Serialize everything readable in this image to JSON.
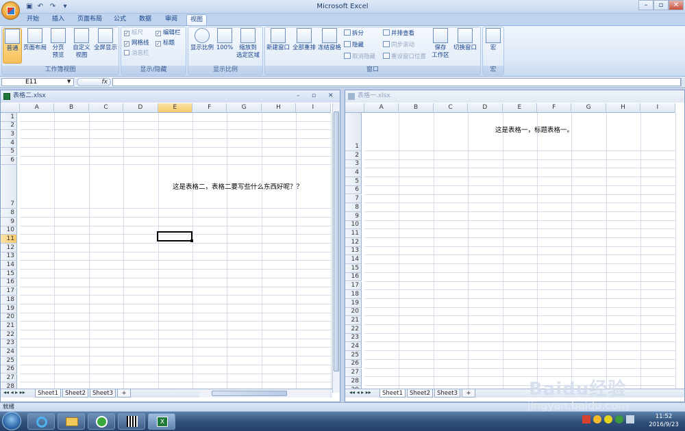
{
  "titlebar": {
    "title": "Microsoft Excel"
  },
  "tabs": [
    "开始",
    "插入",
    "页面布局",
    "公式",
    "数据",
    "审阅",
    "视图"
  ],
  "active_tab": "视图",
  "ribbon": {
    "views": {
      "label": "工作簿视图",
      "normal": "普通",
      "page_layout": "页面布局",
      "page_break": "分页\n预览",
      "custom": "自定义\n视图",
      "fullscreen": "全屏显示"
    },
    "show_hide": {
      "label": "显示/隐藏",
      "ruler": "标尺",
      "gridlines": "网格线",
      "message_bar": "消息栏",
      "formula_bar": "编辑栏",
      "headings": "标题",
      "ruler_checked": true,
      "gridlines_checked": true,
      "message_bar_checked": false,
      "formula_bar_checked": true,
      "headings_checked": true
    },
    "zoom": {
      "label": "显示比例",
      "zoom": "显示比例",
      "hundred": "100%",
      "zoom_selection": "缩放到\n选定区域"
    },
    "window": {
      "label": "窗口",
      "new_window": "新建窗口",
      "arrange_all": "全部重排",
      "freeze": "冻结窗格",
      "split": "拆分",
      "hide": "隐藏",
      "unhide": "取消隐藏",
      "side_by_side": "并排查看",
      "sync_scroll": "同步滚动",
      "reset_pos": "重设窗口位置",
      "save_workspace": "保存\n工作区",
      "switch_windows": "切换窗口"
    },
    "macros": {
      "label": "宏",
      "macros": "宏"
    }
  },
  "formula_bar": {
    "name_box": "E11",
    "fx": "fx",
    "value": ""
  },
  "left_workbook": {
    "title": "表格二.xlsx",
    "columns": [
      "A",
      "B",
      "C",
      "D",
      "E",
      "F",
      "G",
      "H",
      "I"
    ],
    "selected_column": "E",
    "rows": [
      "1",
      "2",
      "3",
      "4",
      "5",
      "6",
      "7",
      "8",
      "9",
      "10",
      "11",
      "12",
      "13",
      "14",
      "15",
      "16",
      "17",
      "18",
      "19",
      "20",
      "21",
      "22",
      "23",
      "24",
      "25",
      "26",
      "27",
      "28"
    ],
    "selected_row": "11",
    "cell_text": "这是表格二，表格二要写些什么东西好呢？？",
    "sheets": [
      "Sheet1",
      "Sheet2",
      "Sheet3"
    ]
  },
  "right_workbook": {
    "title": "表格一.xlsx",
    "columns": [
      "A",
      "B",
      "C",
      "D",
      "E",
      "F",
      "G",
      "H",
      "I"
    ],
    "rows": [
      "1",
      "2",
      "3",
      "4",
      "5",
      "6",
      "7",
      "8",
      "9",
      "10",
      "11",
      "12",
      "13",
      "14",
      "15",
      "16",
      "17",
      "18",
      "19",
      "20",
      "21",
      "22",
      "23",
      "24",
      "25",
      "26",
      "27",
      "28",
      "29"
    ],
    "cell_text": "这是表格一，标题表格一。",
    "sheets": [
      "Sheet1",
      "Sheet2",
      "Sheet3"
    ]
  },
  "statusbar": {
    "status": "就绪"
  },
  "taskbar": {
    "time": "11:52",
    "date": "2016/9/23"
  },
  "watermark": {
    "text": "Baidu经验",
    "sub": "jingyan.baidu.com"
  }
}
